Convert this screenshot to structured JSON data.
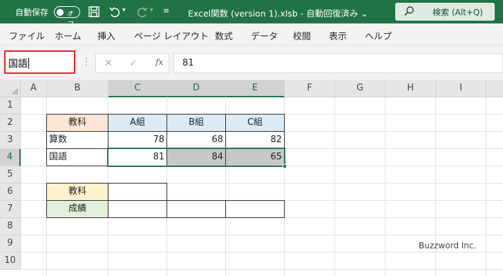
{
  "titlebar": {
    "autosave_label": "自動保存",
    "autosave_state": "オフ",
    "document_title": "Excel関数 (version 1).xlsb  -  自動回復済み  ⌄",
    "search_placeholder": "検索 (Alt+Q)",
    "qa_icons": [
      "save-icon",
      "undo-icon",
      "redo-icon",
      "customize-icon"
    ]
  },
  "menu": [
    "ファイル",
    "ホーム",
    "挿入",
    "ページ レイアウト",
    "数式",
    "データ",
    "校閲",
    "表示",
    "ヘルプ"
  ],
  "formula_bar": {
    "name_box": "国語",
    "cancel_glyph": "✕",
    "enter_glyph": "✓",
    "fx_label": "fx",
    "value": "81"
  },
  "columns": [
    "A",
    "B",
    "C",
    "D",
    "E",
    "F",
    "G",
    "H",
    "I"
  ],
  "rows": [
    "1",
    "2",
    "3",
    "4",
    "5",
    "6",
    "7",
    "8",
    "9",
    "10"
  ],
  "table1": {
    "header": [
      "教科",
      "A組",
      "B組",
      "C組"
    ],
    "rows": [
      [
        "算数",
        "78",
        "68",
        "82"
      ],
      [
        "国語",
        "81",
        "84",
        "65"
      ]
    ]
  },
  "table2": {
    "labels": [
      "教科",
      "成績"
    ]
  },
  "colors": {
    "accent": "#217346",
    "namebox_highlight": "#e02020"
  },
  "watermark": "Buzzword Inc."
}
